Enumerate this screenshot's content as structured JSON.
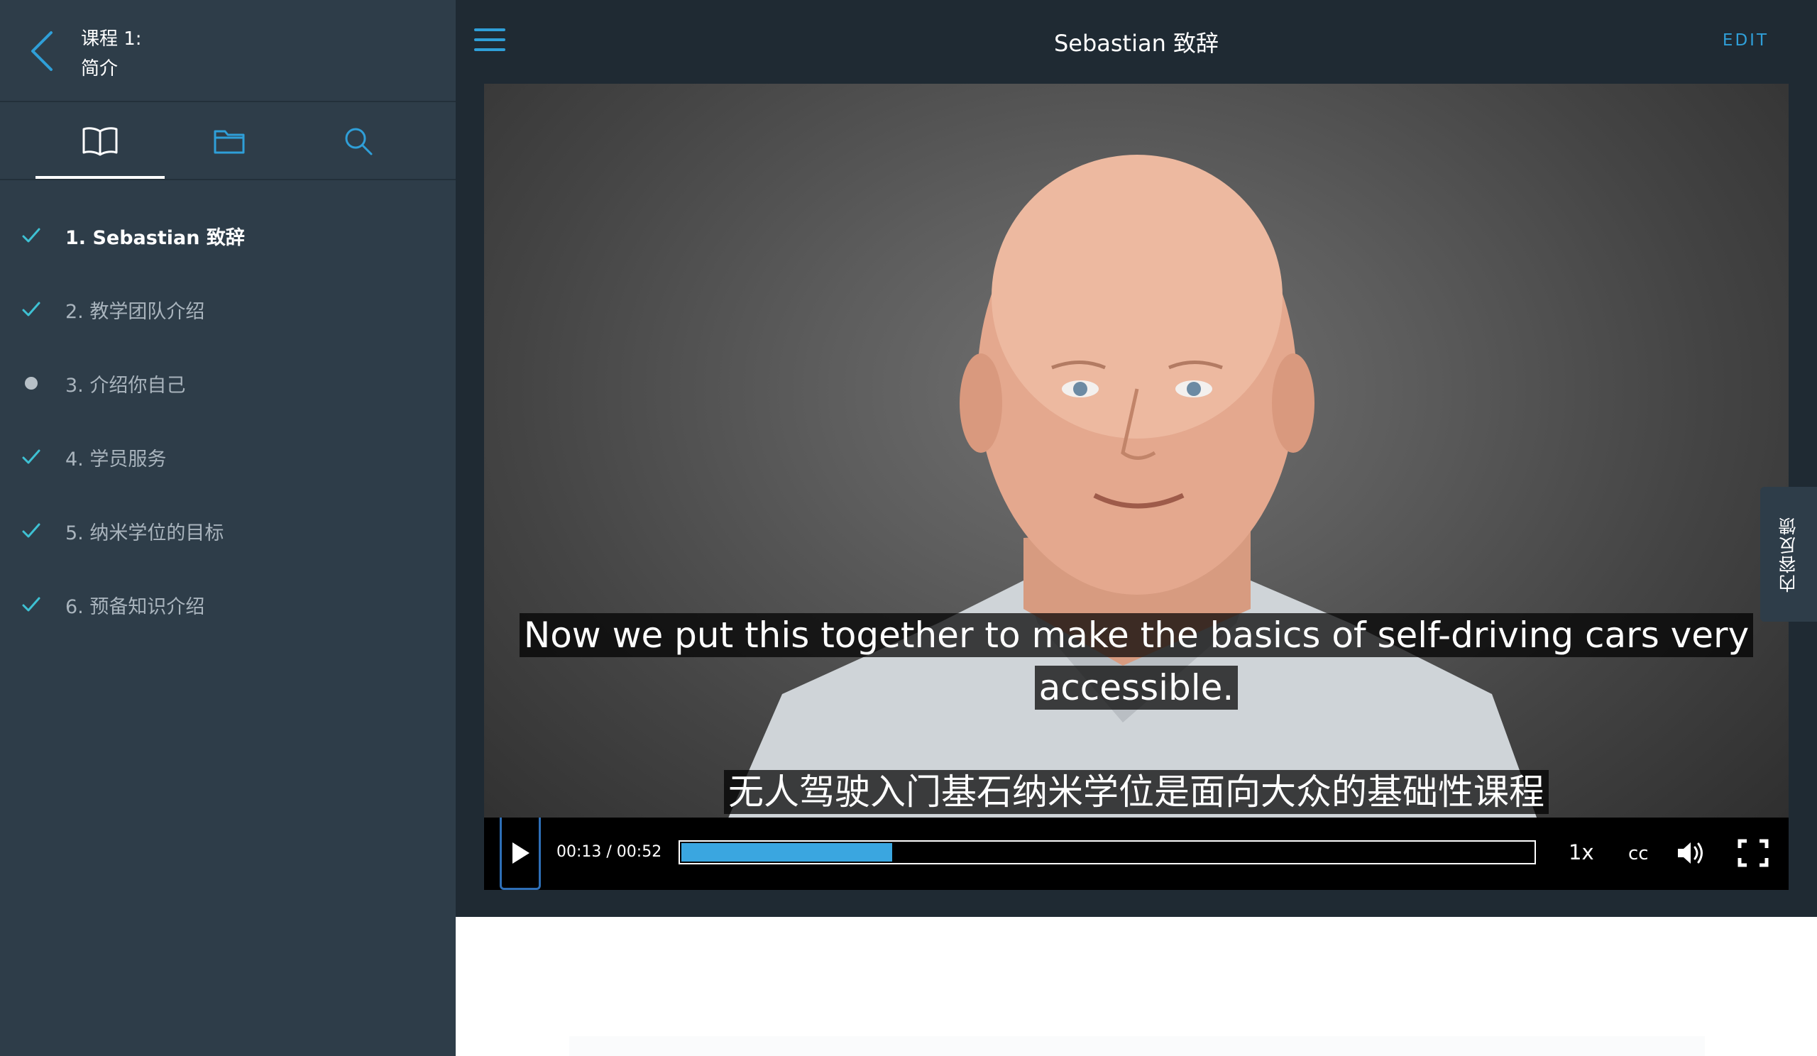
{
  "sidebar": {
    "course_title_line1": "课程 1:",
    "course_title_line2": "简介",
    "tabs": [
      {
        "icon": "book-icon",
        "active": true
      },
      {
        "icon": "folder-icon",
        "active": false
      },
      {
        "icon": "search-icon",
        "active": false
      }
    ],
    "lessons": [
      {
        "label": "1. Sebastian 致辞",
        "status": "complete",
        "current": true
      },
      {
        "label": "2. 教学团队介绍",
        "status": "complete",
        "current": false
      },
      {
        "label": "3. 介绍你自己",
        "status": "incomplete",
        "current": false
      },
      {
        "label": "4. 学员服务",
        "status": "complete",
        "current": false
      },
      {
        "label": "5. 纳米学位的目标",
        "status": "complete",
        "current": false
      },
      {
        "label": "6. 预备知识介绍",
        "status": "complete",
        "current": false
      }
    ]
  },
  "header": {
    "title": "Sebastian 致辞",
    "edit_label": "EDIT"
  },
  "video": {
    "subtitle_en": "Now we put this together to make the basics of self-driving cars very accessible.",
    "subtitle_zh": "无人驾驶入门基石纳米学位是面向大众的基础性课程",
    "time": "00:13 / 00:52",
    "progress_fraction": 0.25,
    "speed": "1x",
    "cc_label": "cc"
  },
  "feedback": {
    "label": "内容反馈"
  },
  "colors": {
    "sidebar_bg": "#2e3d49",
    "topbar_bg": "#1f2a33",
    "accent": "#2f9fd8",
    "check": "#3ec1d3",
    "progress": "#3aa6e0"
  }
}
